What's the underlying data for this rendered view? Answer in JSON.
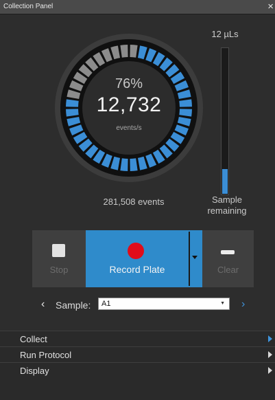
{
  "window": {
    "title": "Collection Panel",
    "close_symbol": "×"
  },
  "gauge": {
    "percent_label": "76%",
    "percent": 0.76,
    "event_rate": "12,732",
    "event_rate_unit": "events/s",
    "total_events": "281,508 events",
    "colors": {
      "active": "#3b8ed6",
      "inactive": "#8c8c8c"
    }
  },
  "sample_volume": {
    "volume_label": "12 µLs",
    "remaining_label_line1": "Sample",
    "remaining_label_line2": "remaining",
    "fill_fraction": 0.17
  },
  "actions": {
    "stop_label": "Stop",
    "record_label": "Record Plate",
    "clear_label": "Clear",
    "stop_icon": "square-icon",
    "record_icon": "record-dot-icon",
    "clear_icon": "minus-icon",
    "record_color": "#e10c1a",
    "accent_color": "#2f8bcb"
  },
  "sample": {
    "label": "Sample:",
    "value": "A1",
    "prev_symbol": "‹",
    "next_symbol": "›",
    "select_caret": "▼"
  },
  "menu": {
    "items": [
      {
        "label": "Collect",
        "arrow_color": "#3f94dc"
      },
      {
        "label": "Run Protocol",
        "arrow_color": "#d8d8d8"
      },
      {
        "label": "Display",
        "arrow_color": "#d8d8d8"
      }
    ]
  }
}
